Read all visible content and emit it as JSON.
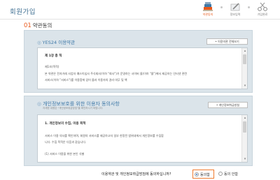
{
  "page": {
    "title": "회원가입"
  },
  "steps": [
    {
      "label": "약관동의",
      "active": true
    },
    {
      "label": "정보입력",
      "active": false
    },
    {
      "label": "가입완료",
      "active": false
    }
  ],
  "section": {
    "number": "01",
    "title": "약관동의"
  },
  "terms": {
    "title": "YES24 이용약관",
    "button": "• 이용약관 전체보기",
    "lines": [
      "제 1장 총 칙",
      "제1조(목적)",
      "본 약관은 전자거래 사업자 예스이십사 주식회사(이하 \"회사\")가 운영하는 사이버 몰(이하 \"몰\")에서 제공하는 인터넷 관련",
      "서비스(이하 \"서비스\")를 이용함에 있어 몰과 이용자의 권리·의무 및 책"
    ]
  },
  "privacy": {
    "title": "개인정보보호를 위한 이용자 동의사항",
    "subtitle": "자세한 내용은 \"개인정보취급방침\"을 확인하시기 바랍니다.",
    "button": "• 개인정보취급방침",
    "lines": [
      "1. 개인정보의 수집, 이용 목적",
      "서비스 이용 의사를 확인하며, 회원의 서비스를 제공하고자 일부 한정된 범위내에서 개인정보를 수집합",
      "니다. 수집 목적은 다음과 같습니다.",
      "(1) 서비스 이용을 위한 본인 식별"
    ]
  },
  "agreement": {
    "question": "이용약관 및 개인정보취급방침에 동의하십니까?",
    "yes": "동의함",
    "no": "동의 안함",
    "selected": "yes"
  },
  "colors": {
    "accent": "#e8581a",
    "link": "#3f79a8",
    "card_bg": "#dbe4ea"
  }
}
